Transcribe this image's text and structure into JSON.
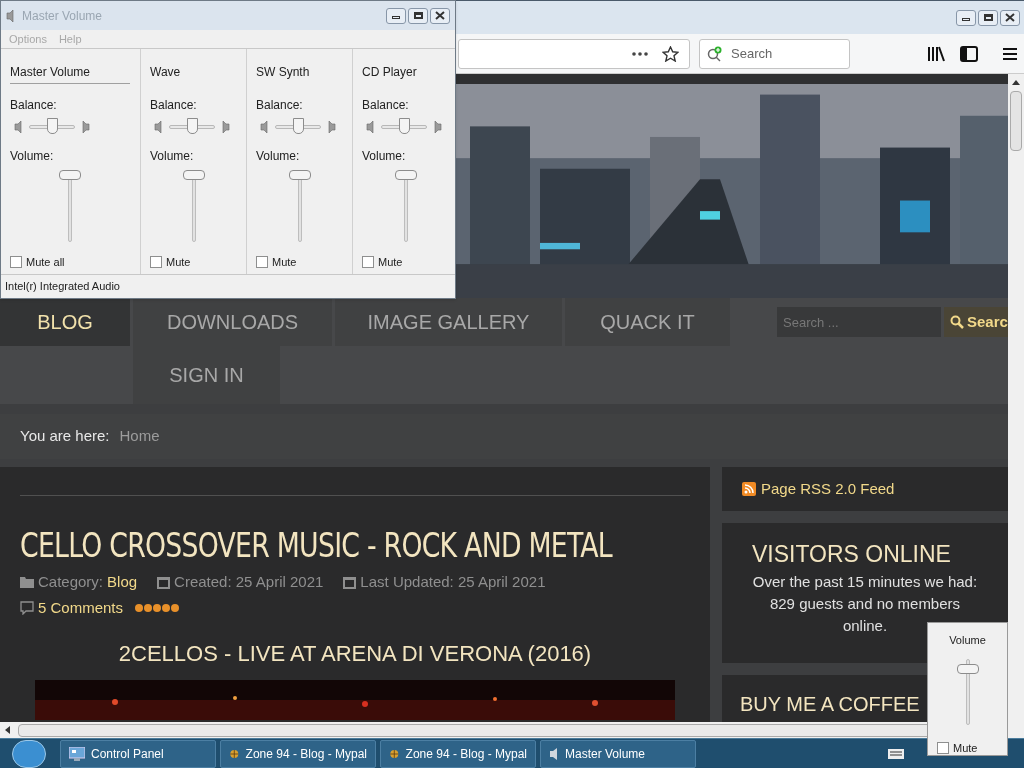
{
  "browser": {
    "search": {
      "placeholder": "Search"
    }
  },
  "site": {
    "nav": [
      {
        "label": "BLOG",
        "selected": true
      },
      {
        "label": "DOWNLOADS",
        "selected": false
      },
      {
        "label": "IMAGE GALLERY",
        "selected": false
      },
      {
        "label": "QUACK IT",
        "selected": false
      },
      {
        "label": "SIGN IN",
        "selected": false
      }
    ],
    "search": {
      "placeholder": "Search ...",
      "button": "Searc"
    },
    "breadcrumb": {
      "label": "You are here:",
      "current": "Home"
    },
    "article": {
      "title": "CELLO CROSSOVER MUSIC - ROCK AND METAL",
      "category_label": "Category:",
      "category": "Blog",
      "created": "Created: 25 April 2021",
      "updated": "Last Updated: 25 April 2021",
      "comments": "5 Comments",
      "stars": 5,
      "video_title": "2CELLOS - LIVE AT ARENA DI VERONA (2016)"
    },
    "sidebar": {
      "rss": "Page RSS 2.0 Feed",
      "visitors_title": "VISITORS ONLINE",
      "visitors_text": "Over the past 15 minutes we had: 829 guests and no members online.",
      "coffee_title": "BUY ME A COFFEE"
    }
  },
  "mixer": {
    "title": "Master Volume",
    "menu": [
      "Options",
      "Help"
    ],
    "channels": [
      {
        "name": "Master Volume",
        "balance_label": "Balance:",
        "balance": {
          "level": 0.5
        },
        "volume_label": "Volume:",
        "volume": {
          "level": 1
        },
        "mute_label": "Mute all",
        "muted": false
      },
      {
        "name": "Wave",
        "balance_label": "Balance:",
        "balance": {
          "level": 0.5
        },
        "volume_label": "Volume:",
        "volume": {
          "level": 1
        },
        "mute_label": "Mute",
        "muted": false
      },
      {
        "name": "SW Synth",
        "balance_label": "Balance:",
        "balance": {
          "level": 0.5
        },
        "volume_label": "Volume:",
        "volume": {
          "level": 1
        },
        "mute_label": "Mute",
        "muted": false
      },
      {
        "name": "CD Player",
        "balance_label": "Balance:",
        "balance": {
          "level": 0.5
        },
        "volume_label": "Volume:",
        "volume": {
          "level": 1
        },
        "mute_label": "Mute",
        "muted": false
      }
    ],
    "status": "Intel(r) Integrated Audio"
  },
  "volume_popup": {
    "label": "Volume",
    "level": 0.9,
    "mute_label": "Mute",
    "muted": false
  },
  "taskbar": {
    "items": [
      {
        "label": "Control Panel",
        "kind": "panel"
      },
      {
        "label": "Zone 94 - Blog - Mypal",
        "kind": "browser"
      },
      {
        "label": "Zone 94 - Blog - Mypal",
        "kind": "browser"
      },
      {
        "label": "Master Volume",
        "kind": "speaker"
      }
    ]
  }
}
